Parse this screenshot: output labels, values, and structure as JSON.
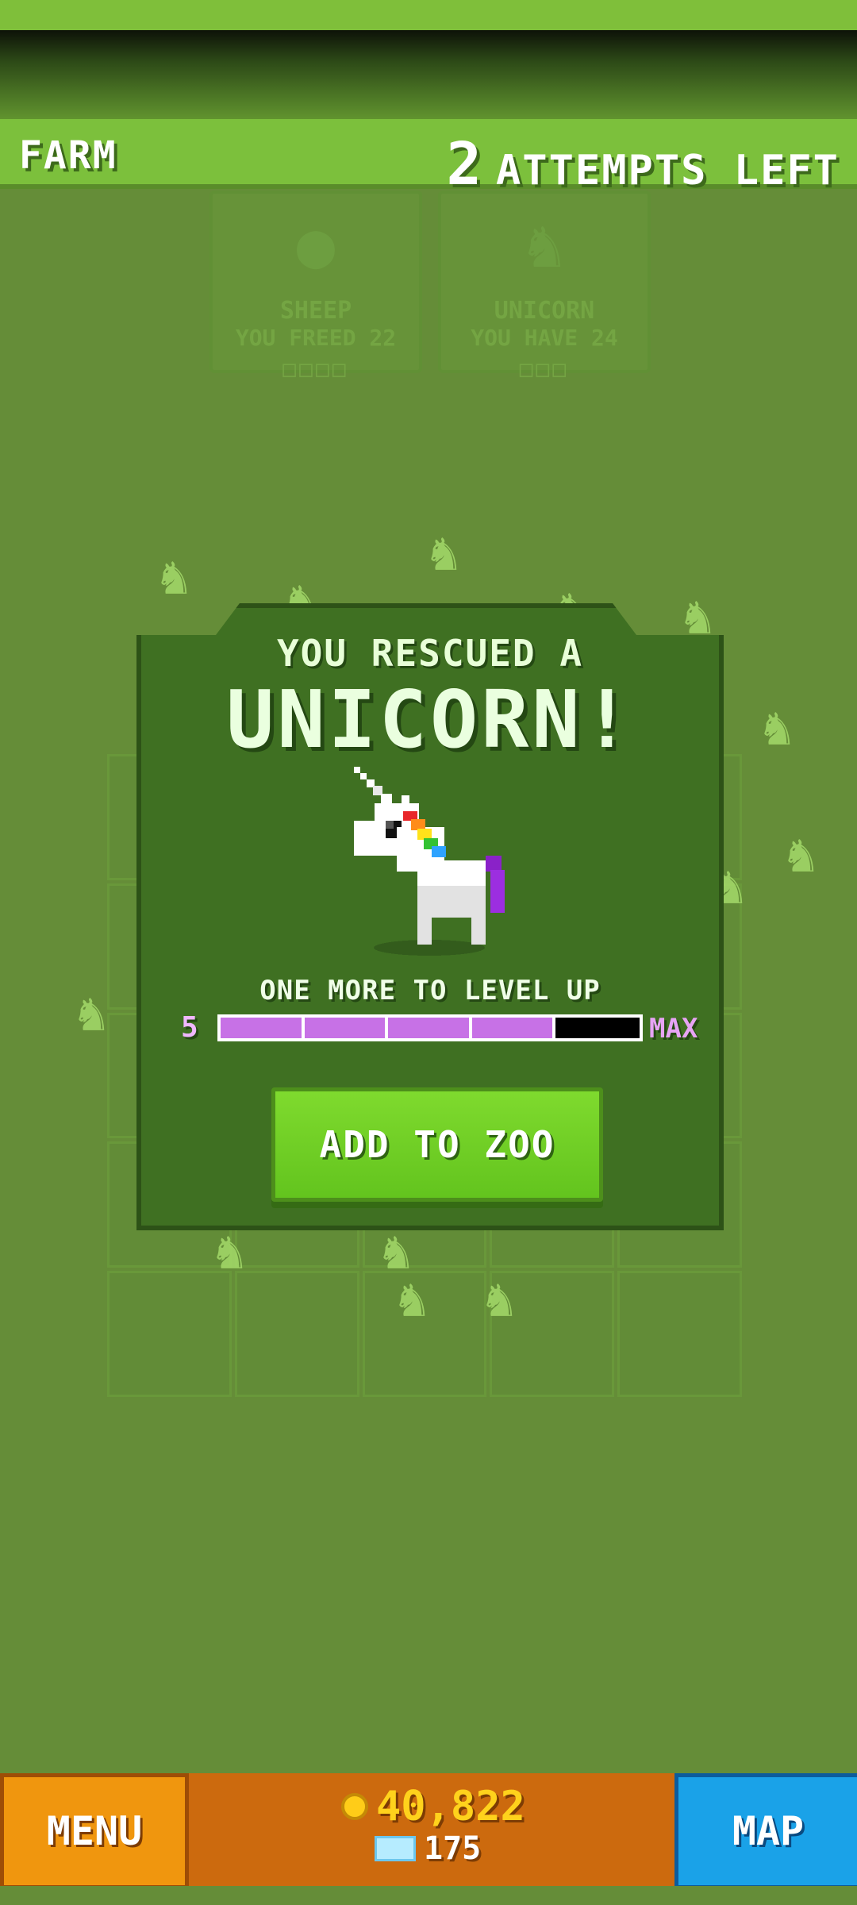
{
  "header": {
    "location": "FARM",
    "attempts_count": "2",
    "attempts_label": "ATTEMPTS LEFT"
  },
  "background_cards": [
    {
      "name": "SHEEP",
      "subtitle": "YOU FREED 22",
      "boxes": "□□□□",
      "icon": "sheep-icon"
    },
    {
      "name": "UNICORN",
      "subtitle": "YOU HAVE 24",
      "boxes": "□□□",
      "icon": "unicorn-icon"
    }
  ],
  "popup": {
    "title_small": "YOU RESCUED A",
    "title_big": "UNICORN!",
    "level_text": "ONE MORE TO LEVEL UP",
    "level": "5",
    "level_max": "MAX",
    "level_progress": 0.8,
    "button": "ADD TO ZOO"
  },
  "footer": {
    "menu": "MENU",
    "map": "MAP",
    "coins": "40,822",
    "gems": "175"
  },
  "colors": {
    "background": "#658d38",
    "header": "#7cc03c",
    "popup": "#3f7022",
    "add_button": "#6fcf25",
    "menu_button": "#f0960e",
    "map_button": "#1aa2e8",
    "progress_fill": "#c771e6",
    "coin": "#ffd21c"
  }
}
